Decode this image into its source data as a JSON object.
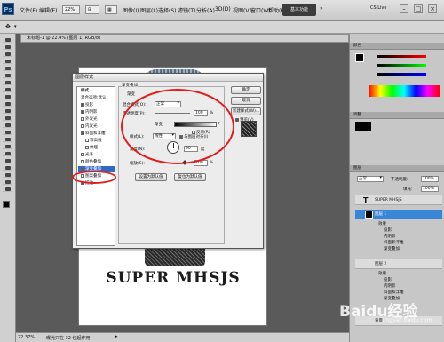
{
  "app": {
    "logo": "Ps",
    "zoom": "22%",
    "workspace": "基本功能",
    "cs_live": "CS Live"
  },
  "menus": [
    "文件(F)",
    "编辑(E)",
    "图像(I)",
    "图层(L)",
    "选择(S)",
    "滤镜(T)",
    "分析(A)",
    "3D(D)",
    "视图(V)",
    "窗口(W)",
    "帮助(H)"
  ],
  "document": {
    "tab": "未标题-1 @ 22.4% (图层 1, RGB/8)",
    "text": "SUPER MHSJS"
  },
  "status": {
    "zoom": "22.37%",
    "doc_info": "曝光只在 32 位起作用"
  },
  "dialog": {
    "title": "图层样式",
    "list_header": "样式",
    "list_blend": "混合选项:默认",
    "styles": [
      "投影",
      "内阴影",
      "外发光",
      "内发光",
      "斜面和浮雕",
      "等高线",
      "纹理",
      "光泽",
      "颜色叠加",
      "渐变叠加",
      "图案叠加",
      "描边"
    ],
    "section": "渐变叠加",
    "group": "渐变",
    "blend_mode_label": "混合模式(O):",
    "blend_mode": "正常",
    "opacity_label": "不透明度(P):",
    "opacity": "100",
    "percent": "%",
    "gradient_label": "渐变:",
    "reverse_label": "反向(R)",
    "style_label": "样式(L):",
    "style_value": "线性",
    "align_label": "与图层对齐(I)",
    "angle_label": "角度(N):",
    "angle": "90",
    "degree": "度",
    "scale_label": "缩放(S):",
    "scale": "100",
    "reset_default": "设置为默认值",
    "restore_default": "复位为默认值",
    "ok": "确定",
    "cancel": "取消",
    "new_style": "新建样式(W)...",
    "preview": "预览(V)"
  },
  "panels": {
    "color_tab": "颜色",
    "adjust_tab": "调整",
    "layers_tab": "图层",
    "blend": "正常",
    "opacity_label": "不透明度:",
    "opacity": "100%",
    "fill_label": "填充:",
    "fill": "100%",
    "layers": [
      {
        "name": "SUPER MHSJS"
      },
      {
        "name": "图层 1"
      },
      {
        "name": "图层 2"
      },
      {
        "name": "背景"
      }
    ],
    "effects_label": "效果",
    "layer1_effects": [
      "投影",
      "内阴影",
      "斜面和浮雕",
      "渐变叠加"
    ],
    "layer2_effects": [
      "投影",
      "内阴影",
      "斜面和浮雕",
      "渐变叠加"
    ]
  },
  "watermark": {
    "main": "Baidu经验",
    "sub": "jingyan.baidu.com"
  }
}
